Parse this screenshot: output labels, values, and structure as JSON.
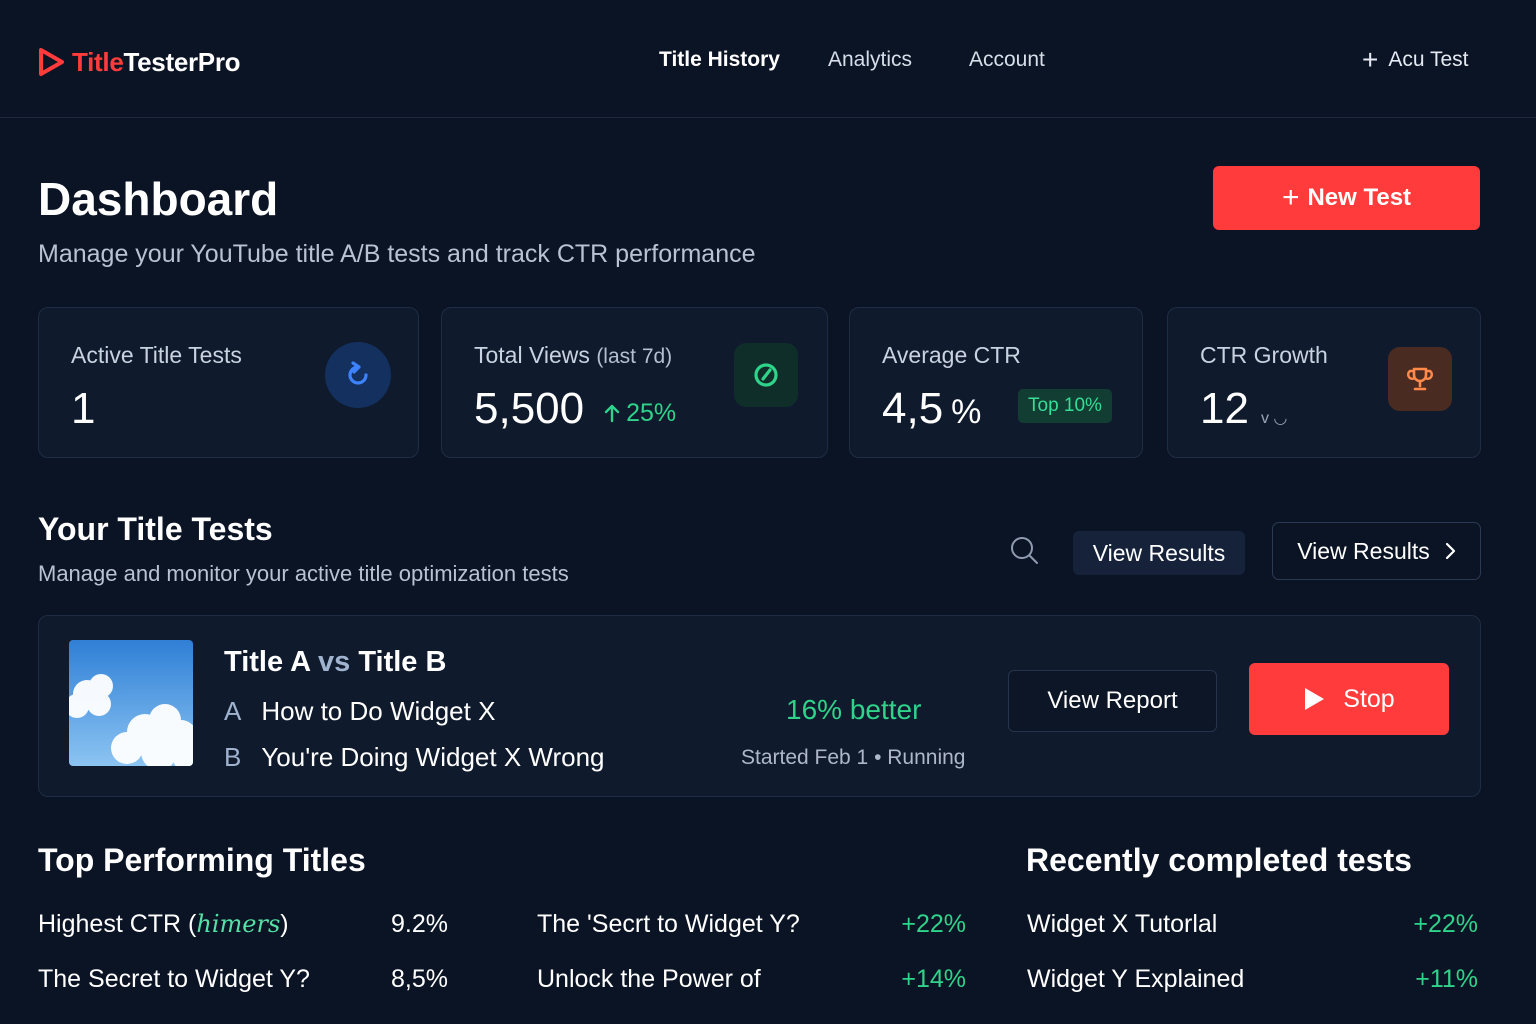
{
  "brand": {
    "part1": "Title",
    "part2": "TesterPro"
  },
  "nav": {
    "items": [
      "Title History",
      "Analytics",
      "Account"
    ],
    "active": "Title History"
  },
  "header_action": {
    "label": "Acu Test"
  },
  "page": {
    "title": "Dashboard",
    "subtitle": "Manage your YouTube title A/B tests and track CTR performance",
    "new_test_label": "New Test"
  },
  "stats": {
    "active_tests": {
      "label": "Active Title Tests",
      "value": "1",
      "icon": "refresh-icon"
    },
    "total_views": {
      "label": "Total Views",
      "label_suffix": "(last 7d)",
      "value": "5,500",
      "delta": "25%",
      "icon": "gauge-icon"
    },
    "avg_ctr": {
      "label": "Average CTR",
      "value": "4,5",
      "unit": "%",
      "badge": "Top 10%"
    },
    "ctr_growth": {
      "label": "CTR Growth",
      "value": "12",
      "unit": "v ◡",
      "icon": "trophy-icon"
    }
  },
  "title_tests": {
    "heading": "Your Title Tests",
    "subheading": "Manage and monitor your active title optimization tests",
    "view_results_ghost": "View Results",
    "view_results_outline": "View Results",
    "test": {
      "title_a": "Title A",
      "vs": "vs",
      "title_b": "Title B",
      "variant_a_tag": "A",
      "variant_a": "How to Do Widget X",
      "variant_b_tag": "B",
      "variant_b": "You're Doing Widget X Wrong",
      "result": "16% better",
      "status": "Started Feb 1 • Running",
      "view_report_label": "View Report",
      "stop_label": "Stop"
    }
  },
  "top_performing": {
    "heading": "Top Performing Titles",
    "col1": [
      {
        "title": "Highest CTR (",
        "scribble": "himers",
        "close": ")",
        "value": "9.2%"
      },
      {
        "title": "The Secret to Widget Y?",
        "value": "8,5%"
      }
    ],
    "col2": [
      {
        "title": "The 'Secrt to Widget Y?",
        "value": "+22%"
      },
      {
        "title": "Unlock the Power of",
        "value": "+14%"
      }
    ]
  },
  "recent": {
    "heading": "Recently completed tests",
    "items": [
      {
        "title": "Widget X Tutorlal",
        "value": "+22%"
      },
      {
        "title": "Widget Y Explained",
        "value": "+11%"
      }
    ]
  },
  "colors": {
    "accent": "#ff3b3b",
    "positive": "#2fd38a",
    "background": "#0b1424",
    "card": "#0f1a2c"
  }
}
